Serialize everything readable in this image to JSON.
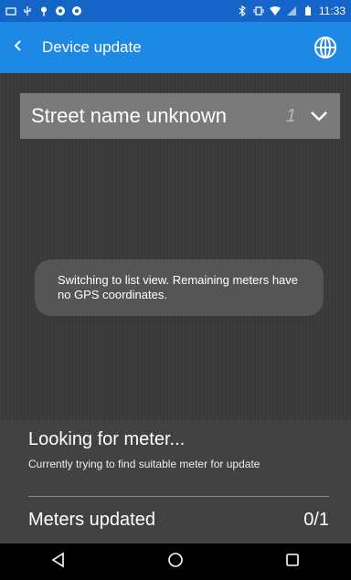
{
  "status_bar": {
    "time": "11:33",
    "left_icons": [
      "screen-icon",
      "usb-icon",
      "location-icon",
      "app-icon",
      "app-icon"
    ],
    "right_icons": [
      "bluetooth-icon",
      "vibrate-icon",
      "wifi-icon",
      "signal-icon",
      "battery-icon"
    ]
  },
  "app_bar": {
    "title": "Device update",
    "back_icon": "chevron-left-icon",
    "globe_icon": "globe-icon",
    "color": "#1e88e5"
  },
  "street_select": {
    "value": "Street name unknown",
    "count": "1",
    "icon": "chevron-down-icon"
  },
  "toast": {
    "message": "Switching to list view. Remaining meters have no GPS coordinates."
  },
  "status_panel": {
    "title": "Looking for meter...",
    "subtitle": "Currently trying to find suitable meter for update",
    "meters_label": "Meters updated",
    "meters_value": "0/1"
  },
  "nav_bar": {
    "icons": [
      "back-triangle-icon",
      "home-circle-icon",
      "recents-square-icon"
    ]
  }
}
